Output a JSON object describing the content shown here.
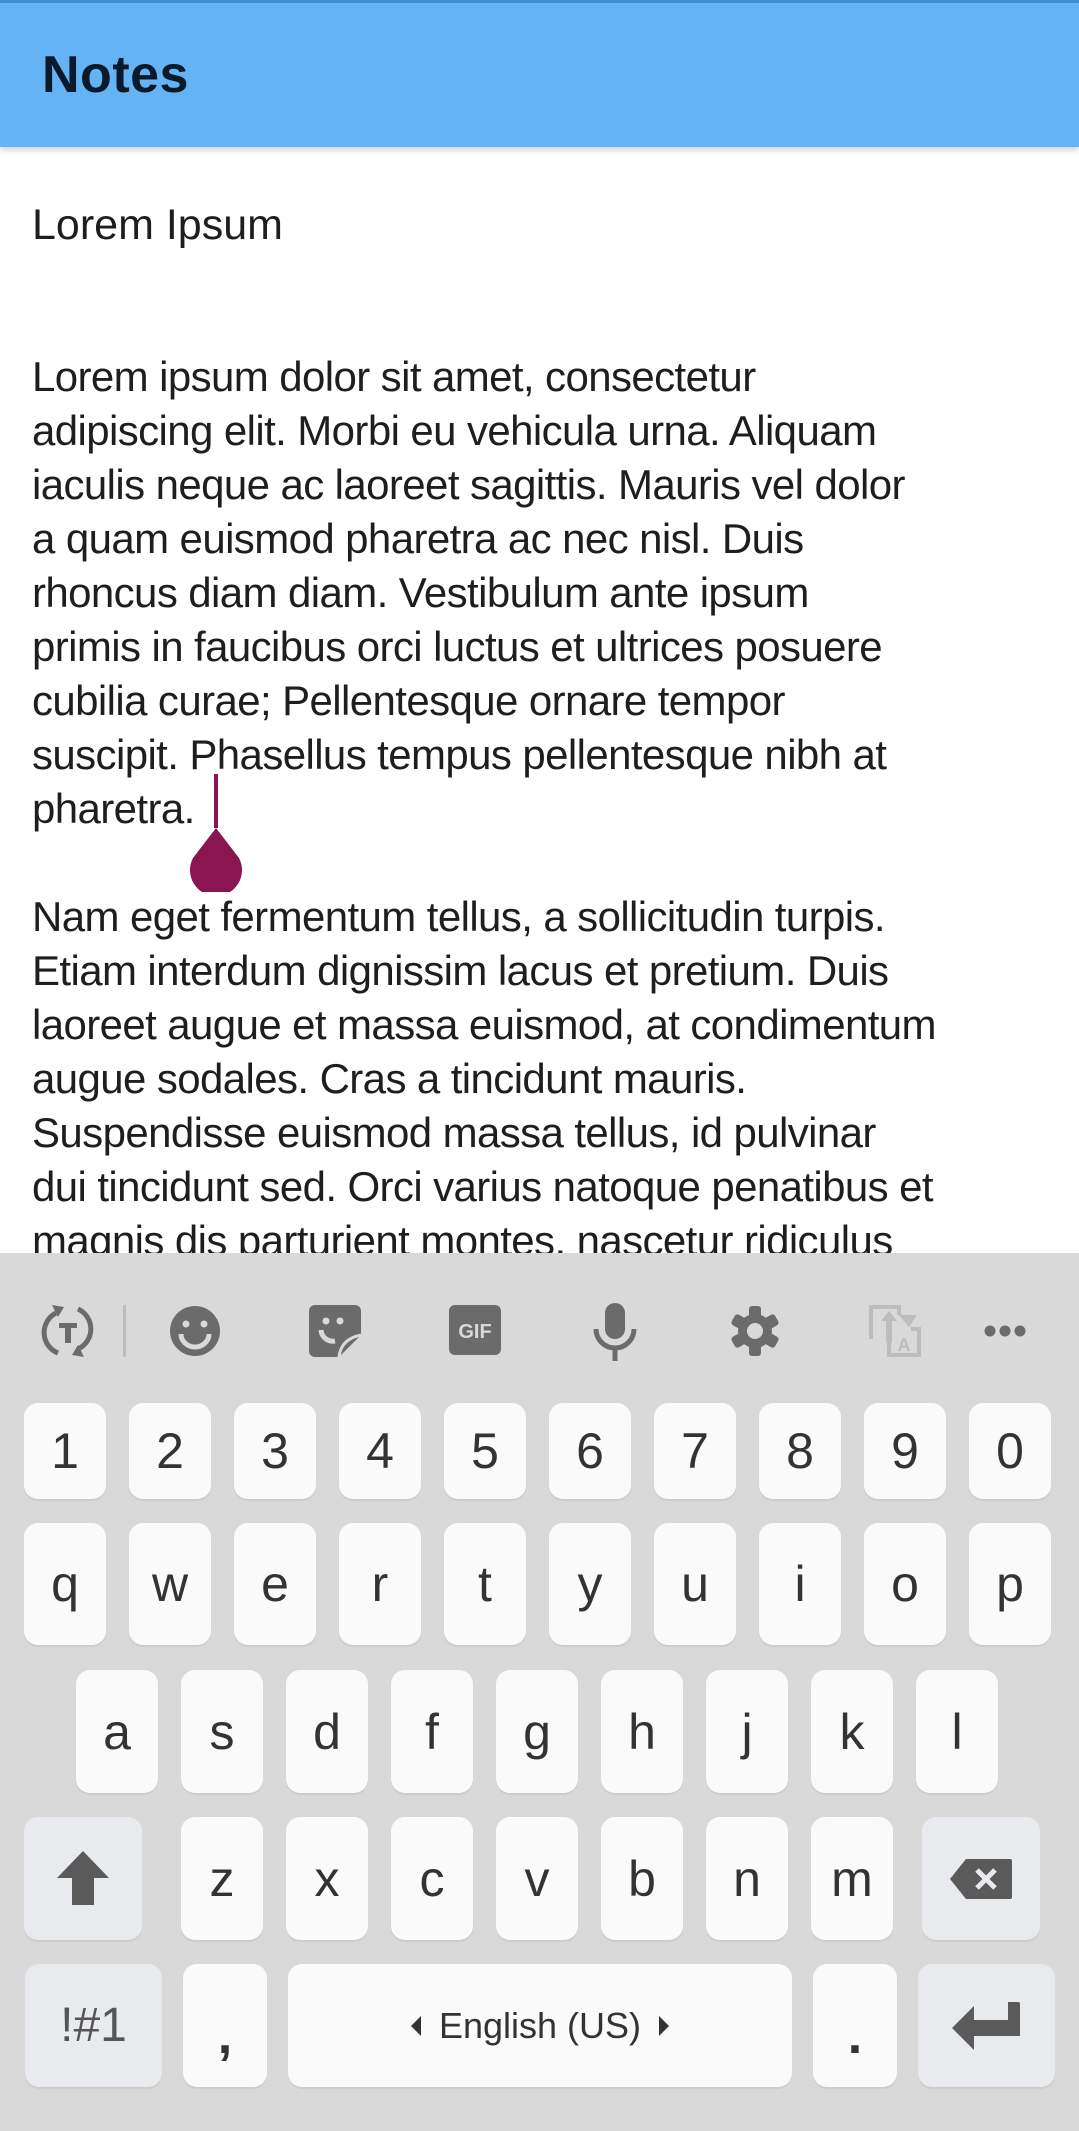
{
  "app_bar": {
    "title": "Notes",
    "color": "#64b4f5"
  },
  "note": {
    "title": "Lorem Ipsum",
    "paragraphs": [
      {
        "lines": [
          "Lorem ipsum dolor sit amet, consectetur",
          "adipiscing elit. Morbi eu vehicula urna. Aliquam",
          "iaculis neque ac laoreet sagittis. Mauris vel dolor",
          "a quam euismod pharetra ac nec nisl. Duis",
          "rhoncus diam diam. Vestibulum ante ipsum",
          "primis in faucibus orci luctus et ultrices posuere",
          "cubilia curae; Pellentesque ornare tempor",
          "suscipit. Phasellus tempus pellentesque nibh at",
          "pharetra."
        ]
      },
      {
        "lines": [
          "Nam eget fermentum tellus, a sollicitudin turpis.",
          "Etiam interdum dignissim lacus et pretium. Duis",
          "laoreet augue et massa euismod, at condimentum",
          "augue sodales. Cras a tincidunt mauris.",
          "Suspendisse euismod massa tellus, id pulvinar",
          "dui tincidunt sed. Orci varius natoque penatibus et",
          "magnis dis parturient montes, nascetur ridiculus"
        ]
      }
    ],
    "cursor_color": "#8a1550"
  },
  "keyboard": {
    "toolbar": [
      {
        "icon": "text-switch-icon"
      },
      {
        "icon": "emoji-icon"
      },
      {
        "icon": "sticker-icon"
      },
      {
        "icon": "gif-icon",
        "label": "GIF"
      },
      {
        "icon": "microphone-icon"
      },
      {
        "icon": "settings-gear-icon"
      },
      {
        "icon": "translate-icon",
        "disabled": true
      },
      {
        "icon": "more-options-icon"
      }
    ],
    "number_row": [
      "1",
      "2",
      "3",
      "4",
      "5",
      "6",
      "7",
      "8",
      "9",
      "0"
    ],
    "row_q": [
      "q",
      "w",
      "e",
      "r",
      "t",
      "y",
      "u",
      "i",
      "o",
      "p"
    ],
    "row_a": [
      "a",
      "s",
      "d",
      "f",
      "g",
      "h",
      "j",
      "k",
      "l"
    ],
    "row_z": [
      "z",
      "x",
      "c",
      "v",
      "b",
      "n",
      "m"
    ],
    "shift_icon": "shift-arrow-icon",
    "backspace_icon": "backspace-icon",
    "symbols_label": "!#1",
    "comma_label": ",",
    "space_label": "English (US)",
    "period_label": ".",
    "enter_icon": "enter-icon"
  }
}
